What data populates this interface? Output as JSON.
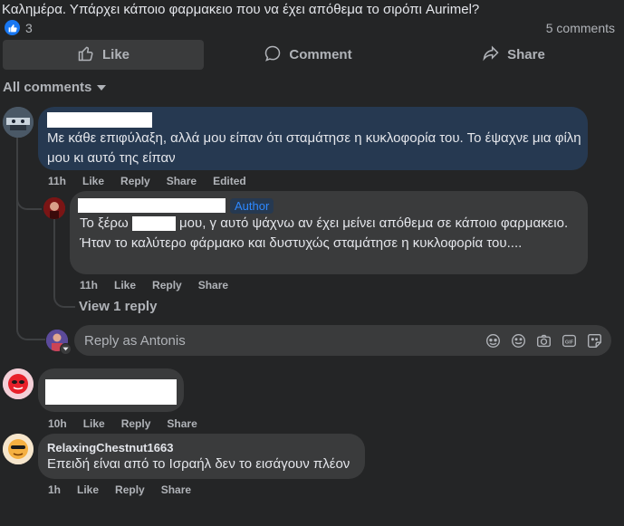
{
  "post": {
    "text": "Καλημέρα. Υπάρχει κάποιο φαρμακειο που να έχει απόθεμα το σιρόπι Aurimel?",
    "reaction_count": "3",
    "comment_count": "5 comments"
  },
  "actions": {
    "like": "Like",
    "comment": "Comment",
    "share": "Share"
  },
  "filter": {
    "label": "All comments"
  },
  "comments": [
    {
      "text": "Με κάθε επιφύλαξη, αλλά μου είπαν ότι σταμάτησε η κυκλοφορία του. Το έψαχνε μια φίλη μου κι αυτό της είπαν",
      "time": "11h",
      "like": "Like",
      "reply": "Reply",
      "share": "Share",
      "edited": "Edited"
    },
    {
      "author_badge": "Author",
      "text_a": "Το ξέρω",
      "text_b": "μου, γ αυτό ψάχνω αν έχει μείνει απόθεμα σε κάποιο φαρμακειο. Ήταν το καλύτερο φάρμακο και δυστυχώς σταμάτησε η κυκλοφορία του....",
      "time": "11h",
      "like": "Like",
      "reply": "Reply",
      "share": "Share"
    },
    {
      "time": "10h",
      "like": "Like",
      "reply": "Reply",
      "share": "Share"
    },
    {
      "author": "RelaxingChestnut1663",
      "text": "Επειδή είναι από το Ισραήλ δεν το εισάγουν πλέον",
      "time": "1h",
      "like": "Like",
      "reply": "Reply",
      "share": "Share"
    }
  ],
  "view_replies": "View 1 reply",
  "reply_input": {
    "placeholder": "Reply as Antonis"
  },
  "icons": [
    "like-reaction-icon",
    "thumbs-up-icon",
    "comment-icon",
    "share-icon",
    "chevron-down-icon",
    "avatar-icon",
    "sticker-icon",
    "emoji-icon",
    "camera-icon",
    "gif-icon",
    "sticker-smile-icon"
  ],
  "colors": {
    "background": "#242526",
    "accent": "#1877f2",
    "highlight_bubble": "#263951",
    "bubble": "#3a3b3c"
  }
}
